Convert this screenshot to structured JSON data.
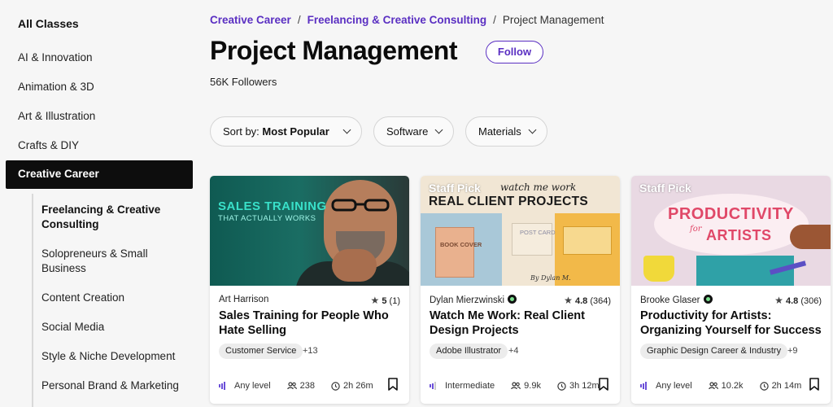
{
  "sidebar": {
    "heading": "All Classes",
    "categories": [
      "AI & Innovation",
      "Animation & 3D",
      "Art & Illustration",
      "Crafts & DIY"
    ],
    "active_category": "Creative Career",
    "subcategories": [
      {
        "label": "Freelancing & Creative Consulting",
        "active": true
      },
      {
        "label": "Solopreneurs & Small Business",
        "active": false
      },
      {
        "label": "Content Creation",
        "active": false
      },
      {
        "label": "Social Media",
        "active": false
      },
      {
        "label": "Style & Niche Development",
        "active": false
      },
      {
        "label": "Personal Brand & Marketing",
        "active": false
      }
    ]
  },
  "breadcrumb": {
    "items": [
      "Creative Career",
      "Freelancing & Creative Consulting"
    ],
    "separator": "/",
    "current": "Project Management"
  },
  "header": {
    "title": "Project Management",
    "follow_label": "Follow",
    "followers": "56K Followers"
  },
  "filters": {
    "sort_prefix": "Sort by:",
    "sort_value": "Most Popular",
    "software": "Software",
    "materials": "Materials"
  },
  "cards": [
    {
      "teacher": "Art Harrison",
      "pro": false,
      "rating": "5",
      "reviews": "(1)",
      "title": "Sales Training for People Who Hate Selling",
      "tag": "Customer Service",
      "tag_more": "+13",
      "level": "Any level",
      "students": "238",
      "duration": "2h 26m",
      "thumb_text_1": "SALES TRAINING",
      "thumb_text_2": "THAT ACTUALLY WORKS"
    },
    {
      "teacher": "Dylan Mierzwinski",
      "pro": true,
      "rating": "4.8",
      "reviews": "(364)",
      "title": "Watch Me Work: Real Client Design Projects",
      "tag": "Adobe Illustrator",
      "tag_more": "+4",
      "level": "Intermediate",
      "students": "9.9k",
      "duration": "3h 12m",
      "staff_pick": "Staff Pick",
      "thumb_text_1": "watch me work",
      "thumb_text_2": "REAL CLIENT PROJECTS",
      "thumb_book": "BOOK COVER",
      "thumb_card": "POST CARD",
      "thumb_sig": "By Dylan M."
    },
    {
      "teacher": "Brooke Glaser",
      "pro": true,
      "rating": "4.8",
      "reviews": "(306)",
      "title": "Productivity for Artists: Organizing Yourself for Success",
      "tag": "Graphic Design Career & Industry",
      "tag_more": "+9",
      "level": "Any level",
      "students": "10.2k",
      "duration": "2h 14m",
      "staff_pick": "Staff Pick",
      "thumb_text_1": "PRODUCTIVITY",
      "thumb_text_2": "for",
      "thumb_text_3": "ARTISTS"
    }
  ],
  "colors": {
    "accent": "#5a2fc2",
    "active_bg": "#0d0d0d",
    "level_bar": "#6b4fd8"
  }
}
